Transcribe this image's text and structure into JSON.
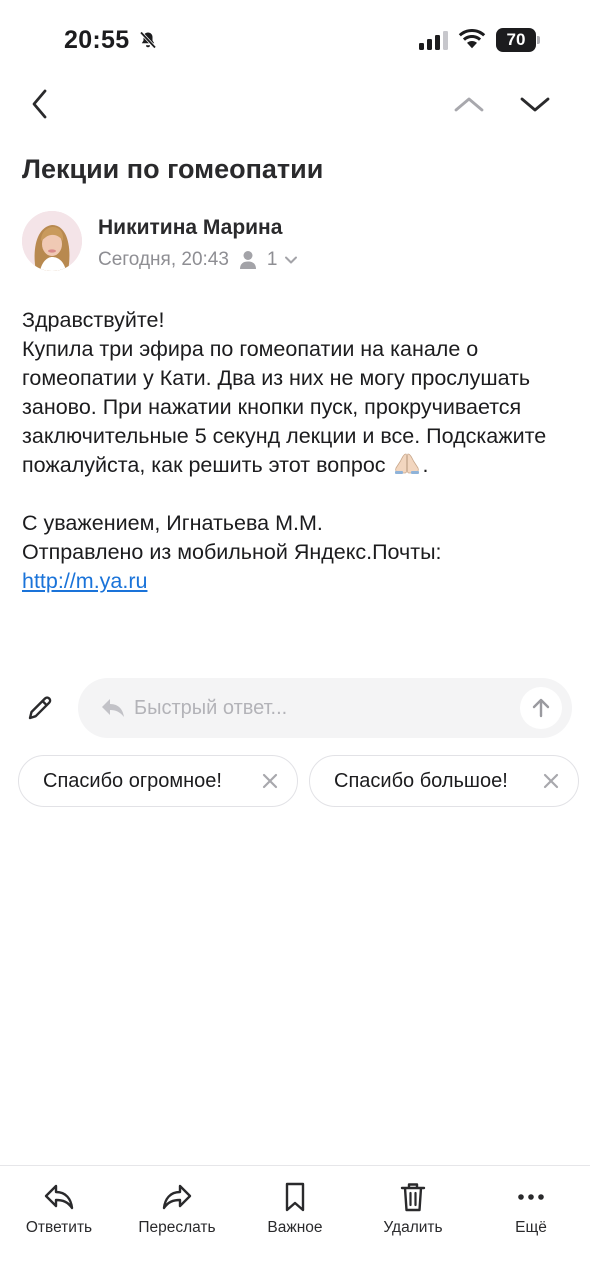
{
  "status_bar": {
    "time": "20:55",
    "battery": "70",
    "icons": [
      "bell-slash-icon",
      "cellular-signal-icon",
      "wifi-icon",
      "battery-icon"
    ]
  },
  "nav": {
    "icons": [
      "chevron-left-icon",
      "chevron-up-icon",
      "chevron-down-icon"
    ]
  },
  "message": {
    "subject": "Лекции по гомеопатии",
    "sender_name": "Никитина Марина",
    "time": "Сегодня, 20:43",
    "recipient_count": "1",
    "body": {
      "greeting": "Здравствуйте!",
      "text": "Купила три эфира по гомеопатии на канале о гомеопатии у Кати. Два из них не могу прослушать заново. При нажатии кнопки пуск, прокручивается заключительные 5 секунд лекции и все. Подскажите пожалуйста, как решить этот вопрос",
      "emoji_suffix": ".",
      "signature": "С уважением, Игнатьева М.М.",
      "sent_from": "Отправлено из мобильной Яндекс.Почты:",
      "link": "http://m.ya.ru"
    }
  },
  "quick_reply": {
    "placeholder": "Быстрый ответ..."
  },
  "suggestions": [
    {
      "label": "Спасибо огромное!"
    },
    {
      "label": "Спасибо большое!"
    }
  ],
  "toolbar": {
    "reply": "Ответить",
    "forward": "Переслать",
    "important": "Важное",
    "delete": "Удалить",
    "more": "Ещё"
  },
  "colors": {
    "link": "#1a73d9",
    "secondary_text": "#8e8e93",
    "reply_box_bg": "#f4f4f5"
  }
}
